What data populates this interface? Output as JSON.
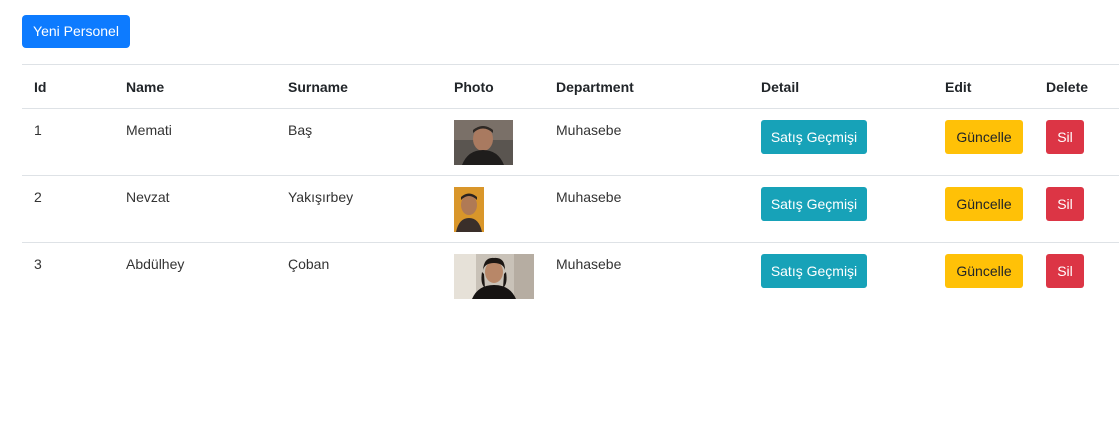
{
  "toolbar": {
    "new_button_label": "Yeni Personel"
  },
  "table": {
    "headers": [
      "Id",
      "Name",
      "Surname",
      "Photo",
      "Department",
      "Detail",
      "Edit",
      "Delete"
    ],
    "rows": [
      {
        "id": "1",
        "name": "Memati",
        "surname": "Baş",
        "photo": "portrait-photo",
        "department": "Muhasebe",
        "detail_label": "Satış Geçmişi",
        "edit_label": "Güncelle",
        "delete_label": "Sil"
      },
      {
        "id": "2",
        "name": "Nevzat",
        "surname": "Yakışırbey",
        "photo": "portrait-photo",
        "department": "Muhasebe",
        "detail_label": "Satış Geçmişi",
        "edit_label": "Güncelle",
        "delete_label": "Sil"
      },
      {
        "id": "3",
        "name": "Abdülhey",
        "surname": "Çoban",
        "photo": "portrait-photo",
        "department": "Muhasebe",
        "detail_label": "Satış Geçmişi",
        "edit_label": "Güncelle",
        "delete_label": "Sil"
      }
    ]
  },
  "colors": {
    "primary": "#0d7bff",
    "info": "#17a2b8",
    "warning": "#ffc107",
    "danger": "#dc3545",
    "border": "#dee2e6"
  }
}
